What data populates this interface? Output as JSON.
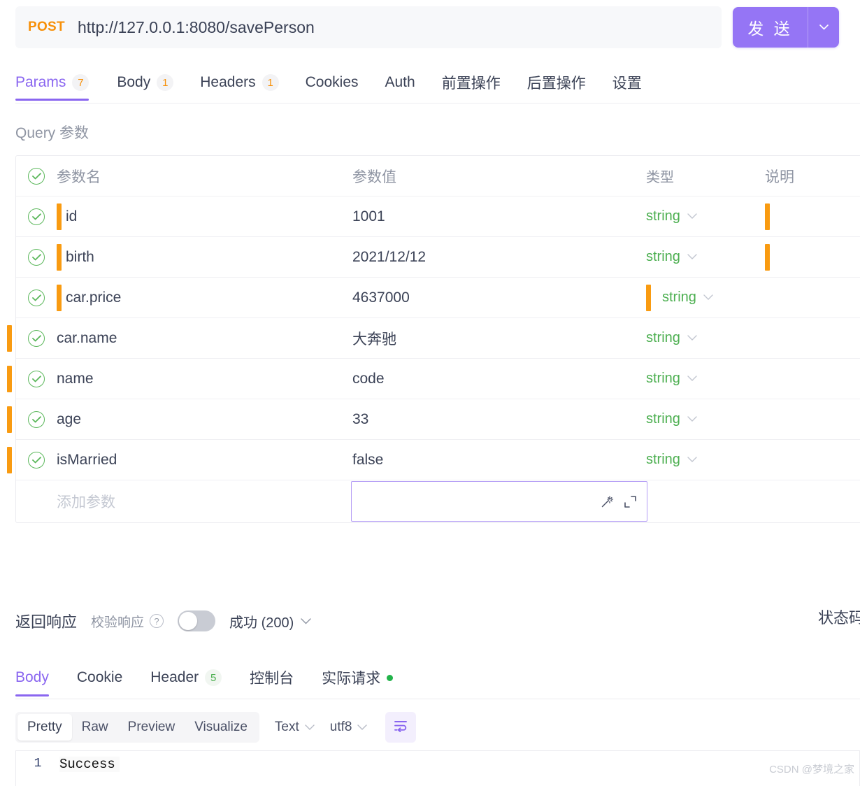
{
  "request": {
    "method": "POST",
    "url": "http://127.0.0.1:8080/savePerson",
    "send_label": "发 送",
    "send_caret_icon": "chevron-down-icon"
  },
  "request_tabs": [
    {
      "label": "Params",
      "badge": "7",
      "active": true
    },
    {
      "label": "Body",
      "badge": "1",
      "active": false
    },
    {
      "label": "Headers",
      "badge": "1",
      "active": false
    },
    {
      "label": "Cookies",
      "badge": "",
      "active": false
    },
    {
      "label": "Auth",
      "badge": "",
      "active": false
    },
    {
      "label": "前置操作",
      "badge": "",
      "active": false
    },
    {
      "label": "后置操作",
      "badge": "",
      "active": false
    },
    {
      "label": "设置",
      "badge": "",
      "active": false
    }
  ],
  "params_section": {
    "title": "Query 参数",
    "columns": {
      "name": "参数名",
      "value": "参数值",
      "type": "类型",
      "desc": "说明"
    },
    "rows": [
      {
        "name": "id",
        "value": "1001",
        "type": "string",
        "desc": "",
        "caret_name": true,
        "caret_desc": true,
        "caret_type": false,
        "caret_far_left": false
      },
      {
        "name": "birth",
        "value": "2021/12/12",
        "type": "string",
        "desc": "",
        "caret_name": true,
        "caret_desc": true,
        "caret_type": false,
        "caret_far_left": false
      },
      {
        "name": "car.price",
        "value": "4637000",
        "type": "string",
        "desc": "",
        "caret_name": true,
        "caret_desc": false,
        "caret_type": true,
        "caret_far_left": false
      },
      {
        "name": "car.name",
        "value": "大奔驰",
        "type": "string",
        "desc": "",
        "caret_name": false,
        "caret_desc": false,
        "caret_type": false,
        "caret_far_left": true
      },
      {
        "name": "name",
        "value": "code",
        "type": "string",
        "desc": "",
        "caret_name": false,
        "caret_desc": false,
        "caret_type": false,
        "caret_far_left": true
      },
      {
        "name": "age",
        "value": "33",
        "type": "string",
        "desc": "",
        "caret_name": false,
        "caret_desc": false,
        "caret_type": false,
        "caret_far_left": true
      },
      {
        "name": "isMarried",
        "value": "false",
        "type": "string",
        "desc": "",
        "caret_name": false,
        "caret_desc": false,
        "caret_type": false,
        "caret_far_left": true
      }
    ],
    "add_row": {
      "name_placeholder": "添加参数",
      "value": "",
      "magic_icon": "magic-wand-icon",
      "expand_icon": "expand-icon"
    },
    "type_chevron_icon": "chevron-down-icon",
    "check_icon": "check-circle-icon"
  },
  "response_header": {
    "title": "返回响应",
    "verify_label": "校验响应",
    "help_icon": "question-mark-icon",
    "toggle_on": false,
    "status_select": "成功 (200)",
    "status_chevron_icon": "chevron-down-icon",
    "status_code_label": "状态码"
  },
  "response_tabs": [
    {
      "label": "Body",
      "badge": "",
      "active": true,
      "dot": false
    },
    {
      "label": "Cookie",
      "badge": "",
      "active": false,
      "dot": false
    },
    {
      "label": "Header",
      "badge": "5",
      "active": false,
      "dot": false
    },
    {
      "label": "控制台",
      "badge": "",
      "active": false,
      "dot": false
    },
    {
      "label": "实际请求",
      "badge": "",
      "active": false,
      "dot": true
    }
  ],
  "format_toolbar": {
    "segments": [
      {
        "label": "Pretty",
        "active": true
      },
      {
        "label": "Raw",
        "active": false
      },
      {
        "label": "Preview",
        "active": false
      },
      {
        "label": "Visualize",
        "active": false
      }
    ],
    "type_select": "Text",
    "charset_select": "utf8",
    "chevron_icon": "chevron-down-icon",
    "wrap_icon": "word-wrap-icon"
  },
  "response_body": {
    "lines": [
      {
        "no": "1",
        "text": "Success"
      }
    ]
  },
  "watermark": "CSDN @梦境之家",
  "colors": {
    "accent": "#8a66f0",
    "send_bg": "#9575f5",
    "method": "#f79009",
    "caret": "#f99b11",
    "type_green": "#4caf50",
    "check_green": "#5cb85c"
  }
}
